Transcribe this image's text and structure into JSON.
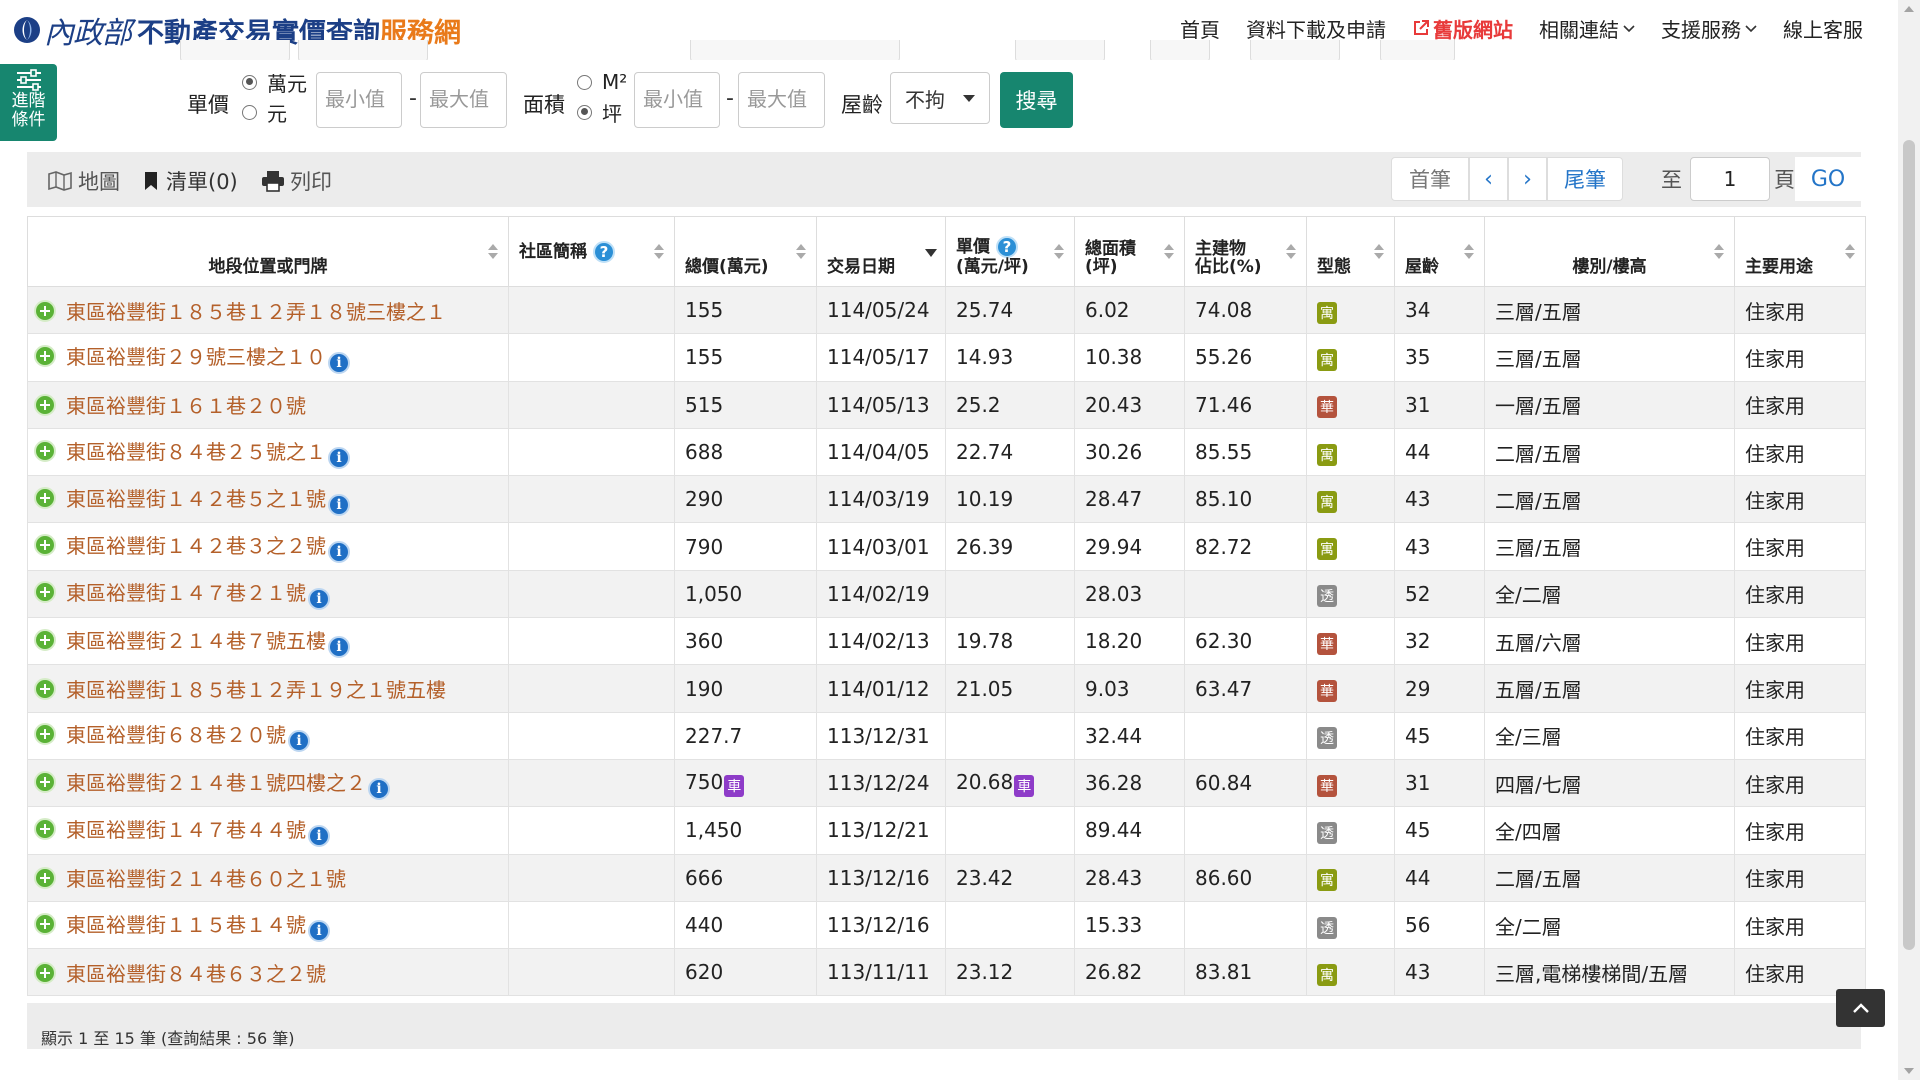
{
  "brand": {
    "logo_text": "內政部",
    "title_main": "不動產交易實價查詢",
    "title_accent": "服務網",
    "colors": {
      "primary": "#1c3f86",
      "accent": "#e97a1a"
    }
  },
  "nav": {
    "home": "首頁",
    "download": "資料下載及申請",
    "old_site": "舊版網站",
    "related": "相關連結",
    "support": "支援服務",
    "service": "線上客服"
  },
  "search": {
    "advanced_label": "進階條件",
    "unit_price_label": "單價",
    "unit_wan": "萬元",
    "unit_yuan": "元",
    "min_placeholder": "最小值",
    "max_placeholder": "最大值",
    "dash": "-",
    "area_label": "面積",
    "area_m2": "M²",
    "area_ping": "坪",
    "age_label": "屋齡",
    "age_value": "不拘",
    "search_button": "搜尋",
    "accent_color": "#17866f"
  },
  "toolbar": {
    "map": "地圖",
    "list": "清單(0)",
    "print": "列印"
  },
  "pager": {
    "first": "首筆",
    "prev": "‹",
    "next": "›",
    "last": "尾筆",
    "to": "至",
    "page_value": "1",
    "page_unit": "頁",
    "go": "GO"
  },
  "table": {
    "headers": {
      "address": "地段位置或門牌",
      "community": "社區簡稱",
      "total_price": "總價(萬元)",
      "date": "交易日期",
      "unit_price_1": "單價",
      "unit_price_2": "(萬元/坪)",
      "area_1": "總面積",
      "area_2": "(坪)",
      "main_ratio_1": "主建物",
      "main_ratio_2": "佔比(%)",
      "type": "型態",
      "age": "屋齡",
      "floor": "樓別/樓高",
      "use": "主要用途"
    },
    "rows": [
      {
        "address": "東區裕豐街１８５巷１２弄１８號三樓之１",
        "info": false,
        "community": "",
        "total": "155",
        "total_car": false,
        "date": "114/05/24",
        "unit": "25.74",
        "unit_car": false,
        "area": "6.02",
        "ratio": "74.08",
        "type": "寓",
        "type_kind": "yu",
        "age": "34",
        "floor": "三層/五層",
        "use": "住家用"
      },
      {
        "address": "東區裕豐街２９號三樓之１０",
        "info": true,
        "community": "",
        "total": "155",
        "total_car": false,
        "date": "114/05/17",
        "unit": "14.93",
        "unit_car": false,
        "area": "10.38",
        "ratio": "55.26",
        "type": "寓",
        "type_kind": "yu",
        "age": "35",
        "floor": "三層/五層",
        "use": "住家用"
      },
      {
        "address": "東區裕豐街１６１巷２０號",
        "info": false,
        "community": "",
        "total": "515",
        "total_car": false,
        "date": "114/05/13",
        "unit": "25.2",
        "unit_car": false,
        "area": "20.43",
        "ratio": "71.46",
        "type": "華",
        "type_kind": "hua",
        "age": "31",
        "floor": "一層/五層",
        "use": "住家用"
      },
      {
        "address": "東區裕豐街８４巷２５號之１",
        "info": true,
        "community": "",
        "total": "688",
        "total_car": false,
        "date": "114/04/05",
        "unit": "22.74",
        "unit_car": false,
        "area": "30.26",
        "ratio": "85.55",
        "type": "寓",
        "type_kind": "yu",
        "age": "44",
        "floor": "二層/五層",
        "use": "住家用"
      },
      {
        "address": "東區裕豐街１４２巷５之１號",
        "info": true,
        "community": "",
        "total": "290",
        "total_car": false,
        "date": "114/03/19",
        "unit": "10.19",
        "unit_car": false,
        "area": "28.47",
        "ratio": "85.10",
        "type": "寓",
        "type_kind": "yu",
        "age": "43",
        "floor": "二層/五層",
        "use": "住家用"
      },
      {
        "address": "東區裕豐街１４２巷３之２號",
        "info": true,
        "community": "",
        "total": "790",
        "total_car": false,
        "date": "114/03/01",
        "unit": "26.39",
        "unit_car": false,
        "area": "29.94",
        "ratio": "82.72",
        "type": "寓",
        "type_kind": "yu",
        "age": "43",
        "floor": "三層/五層",
        "use": "住家用"
      },
      {
        "address": "東區裕豐街１４７巷２１號",
        "info": true,
        "community": "",
        "total": "1,050",
        "total_car": false,
        "date": "114/02/19",
        "unit": "",
        "unit_car": false,
        "area": "28.03",
        "ratio": "",
        "type": "透",
        "type_kind": "tou",
        "age": "52",
        "floor": "全/二層",
        "use": "住家用"
      },
      {
        "address": "東區裕豐街２１４巷７號五樓",
        "info": true,
        "community": "",
        "total": "360",
        "total_car": false,
        "date": "114/02/13",
        "unit": "19.78",
        "unit_car": false,
        "area": "18.20",
        "ratio": "62.30",
        "type": "華",
        "type_kind": "hua",
        "age": "32",
        "floor": "五層/六層",
        "use": "住家用"
      },
      {
        "address": "東區裕豐街１８５巷１２弄１９之１號五樓",
        "info": false,
        "community": "",
        "total": "190",
        "total_car": false,
        "date": "114/01/12",
        "unit": "21.05",
        "unit_car": false,
        "area": "9.03",
        "ratio": "63.47",
        "type": "華",
        "type_kind": "hua",
        "age": "29",
        "floor": "五層/五層",
        "use": "住家用"
      },
      {
        "address": "東區裕豐街６８巷２０號",
        "info": true,
        "community": "",
        "total": "227.7",
        "total_car": false,
        "date": "113/12/31",
        "unit": "",
        "unit_car": false,
        "area": "32.44",
        "ratio": "",
        "type": "透",
        "type_kind": "tou",
        "age": "45",
        "floor": "全/三層",
        "use": "住家用"
      },
      {
        "address": "東區裕豐街２１４巷１號四樓之２",
        "info": true,
        "community": "",
        "total": "750",
        "total_car": true,
        "date": "113/12/24",
        "unit": "20.68",
        "unit_car": true,
        "area": "36.28",
        "ratio": "60.84",
        "type": "華",
        "type_kind": "hua",
        "age": "31",
        "floor": "四層/七層",
        "use": "住家用"
      },
      {
        "address": "東區裕豐街１４７巷４４號",
        "info": true,
        "community": "",
        "total": "1,450",
        "total_car": false,
        "date": "113/12/21",
        "unit": "",
        "unit_car": false,
        "area": "89.44",
        "ratio": "",
        "type": "透",
        "type_kind": "tou",
        "age": "45",
        "floor": "全/四層",
        "use": "住家用"
      },
      {
        "address": "東區裕豐街２１４巷６０之１號",
        "info": false,
        "community": "",
        "total": "666",
        "total_car": false,
        "date": "113/12/16",
        "unit": "23.42",
        "unit_car": false,
        "area": "28.43",
        "ratio": "86.60",
        "type": "寓",
        "type_kind": "yu",
        "age": "44",
        "floor": "二層/五層",
        "use": "住家用"
      },
      {
        "address": "東區裕豐街１１５巷１４號",
        "info": true,
        "community": "",
        "total": "440",
        "total_car": false,
        "date": "113/12/16",
        "unit": "",
        "unit_car": false,
        "area": "15.33",
        "ratio": "",
        "type": "透",
        "type_kind": "tou",
        "age": "56",
        "floor": "全/二層",
        "use": "住家用"
      },
      {
        "address": "東區裕豐街８４巷６３之２號",
        "info": false,
        "community": "",
        "total": "620",
        "total_car": false,
        "date": "113/11/11",
        "unit": "23.12",
        "unit_car": false,
        "area": "26.82",
        "ratio": "83.81",
        "type": "寓",
        "type_kind": "yu",
        "age": "43",
        "floor": "三層,電梯樓梯間/五層",
        "use": "住家用"
      }
    ],
    "car_badge": "車"
  },
  "footer": {
    "summary": "顯示 1 至 15 筆 (查詢結果 : 56 筆)"
  }
}
